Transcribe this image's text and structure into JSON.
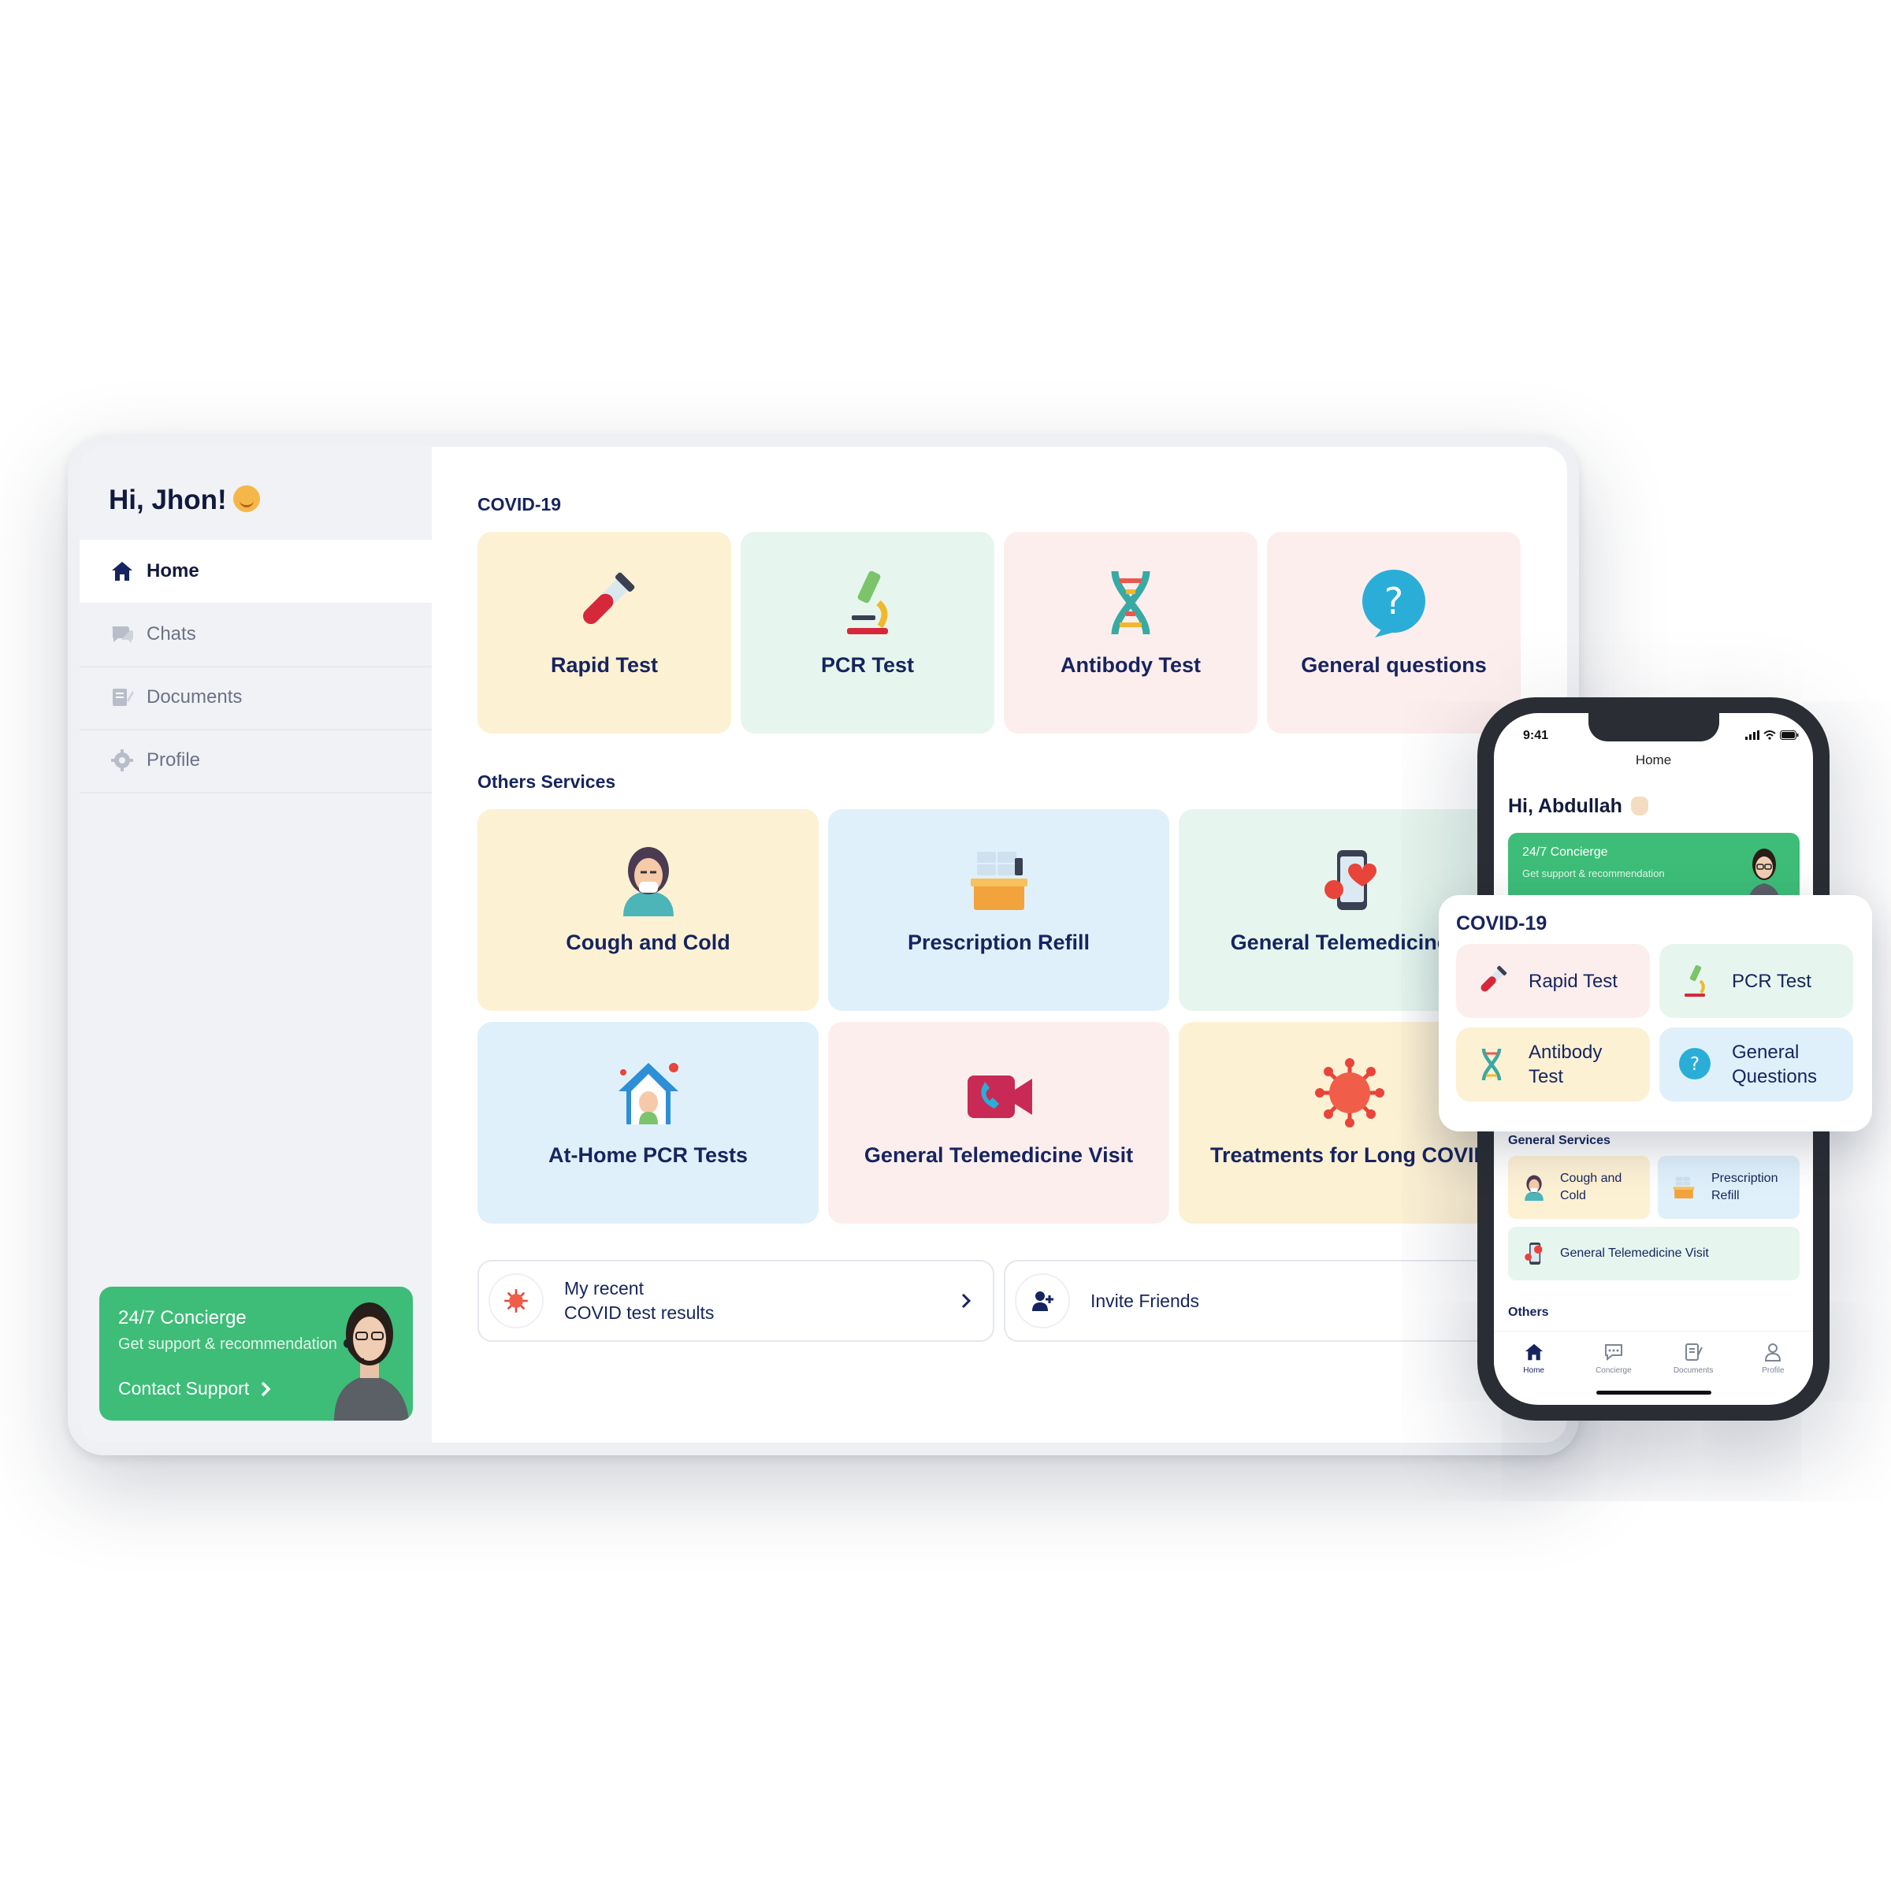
{
  "tablet": {
    "greeting": "Hi, Jhon!",
    "nav": [
      {
        "label": "Home"
      },
      {
        "label": "Chats"
      },
      {
        "label": "Documents"
      },
      {
        "label": "Profile"
      }
    ],
    "concierge": {
      "title": "24/7 Concierge",
      "subtitle": "Get support & recommendation",
      "link": "Contact Support"
    },
    "covid_section": "COVID-19",
    "covid_cards": [
      {
        "label": "Rapid Test",
        "icon": "test-tube-icon"
      },
      {
        "label": "PCR Test",
        "icon": "microscope-icon"
      },
      {
        "label": "Antibody Test",
        "icon": "dna-icon"
      },
      {
        "label": "General questions",
        "icon": "question-bubble-icon"
      }
    ],
    "others_section": "Others Services",
    "other_cards": [
      {
        "label": "Cough and Cold",
        "icon": "sick-person-icon"
      },
      {
        "label": "Prescription Refill",
        "icon": "medicine-box-icon"
      },
      {
        "label": "General Telemedicine V",
        "icon": "phone-heart-icon"
      },
      {
        "label": "At-Home PCR Tests",
        "icon": "home-test-icon"
      },
      {
        "label": "General Telemedicine Visit",
        "icon": "video-call-icon"
      },
      {
        "label": "Treatments for Long COVID",
        "icon": "virus-icon"
      }
    ],
    "recent_results": {
      "line1": "My recent",
      "line2": "COVID test results"
    },
    "invite": {
      "label": "Invite Friends"
    }
  },
  "phone": {
    "time": "9:41",
    "title": "Home",
    "greeting": "Hi, Abdullah",
    "concierge": {
      "title": "24/7 Concierge",
      "subtitle": "Get support & recommendation"
    },
    "covid_section": "COVID-19",
    "covid_cards": [
      {
        "label": "Rapid Test"
      },
      {
        "label": "PCR Test"
      },
      {
        "line1": "Antibody",
        "line2": "Test"
      },
      {
        "line1": "General",
        "line2": "Questions"
      }
    ],
    "general_services": "General Services",
    "service_cards": [
      {
        "line1": "Cough and",
        "line2": "Cold"
      },
      {
        "line1": "Prescription",
        "line2": "Refill"
      },
      {
        "label": "General Telemedicine Visit"
      }
    ],
    "others": "Others",
    "tabs": [
      {
        "label": "Home",
        "icon": "home-icon"
      },
      {
        "label": "Concierge",
        "icon": "chat-icon"
      },
      {
        "label": "Documents",
        "icon": "document-icon"
      },
      {
        "label": "Profile",
        "icon": "person-icon"
      }
    ]
  },
  "colors": {
    "accent_green": "#3dbd78",
    "navy": "#16245f",
    "card_yellow": "#fdf1d4",
    "card_mint": "#e6f6ee",
    "card_pink": "#fdeeee",
    "card_blue": "#e0f0fb"
  }
}
